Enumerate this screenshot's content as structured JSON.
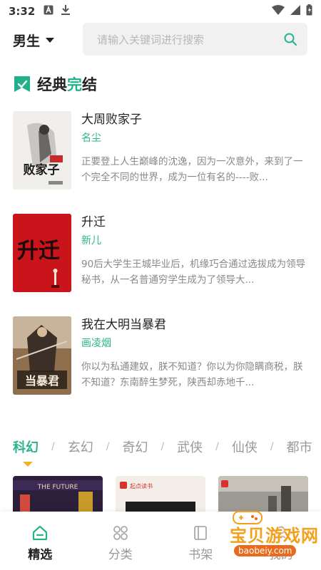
{
  "status_bar": {
    "time": "3:32"
  },
  "header": {
    "gender": "男生",
    "search_placeholder": "请输入关键词进行搜索"
  },
  "section": {
    "title_main": "经典",
    "title_accent": "完",
    "title_end": "结"
  },
  "books": [
    {
      "title": "大周败家子",
      "author": "名尘",
      "desc": "正要登上人生巅峰的沈逸，因为一次意外，来到了一个完全不同的世界，成为一位有名的----败...",
      "cover_text": "败家子"
    },
    {
      "title": "升迁",
      "author": "新儿",
      "desc": "90后大学生王城毕业后，机缘巧合通过选拔成为领导秘书，从一名普通穷学生成为了领导大...",
      "cover_text": "升迁"
    },
    {
      "title": "我在大明当暴君",
      "author": "画凌烟",
      "desc": "你以为私通建奴，朕不知道？你以为你隐瞒商税，朕不知道？东南醉生梦死，陕西却赤地千...",
      "cover_text": "当暴君"
    }
  ],
  "categories": [
    "科幻",
    "玄幻",
    "奇幻",
    "武侠",
    "仙侠",
    "都市"
  ],
  "covers": [
    {
      "label": "THE FUTURE"
    },
    {
      "label": "起点读书"
    },
    {
      "label": ""
    }
  ],
  "nav": [
    {
      "label": "精选"
    },
    {
      "label": "分类"
    },
    {
      "label": "书架"
    },
    {
      "label": "我的"
    }
  ],
  "watermark": {
    "text": "宝贝游戏网",
    "url": "baobeiy.com"
  },
  "colors": {
    "accent": "#2bb48c",
    "indicator": "#f4b223"
  }
}
